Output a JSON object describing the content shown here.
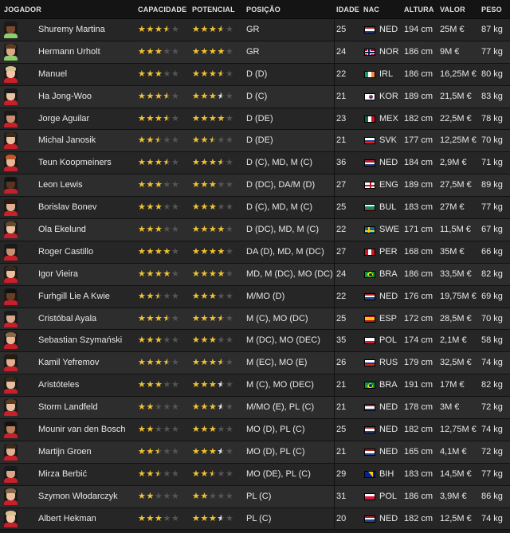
{
  "header": {
    "player": "JOGADOR",
    "ability": "CAPACIDADE",
    "potential": "POTENCIAL",
    "position": "POSIÇÃO",
    "age": "IDADE",
    "nat": "NAC",
    "height": "ALTURA",
    "value": "VALOR",
    "weight": "PESO"
  },
  "colors": {
    "star_gold": "#f2c230",
    "star_white": "#e8e8e8",
    "star_empty": "#555555"
  },
  "players": [
    {
      "name": "Shuremy Martina",
      "ability": 3.5,
      "potential": 3.5,
      "potential_white": false,
      "position": "GR",
      "age": "25",
      "nat": "NED",
      "height": "194 cm",
      "value": "25M €",
      "weight": "87 kg",
      "skin": "#7a4a2e",
      "hair": "#1a1a1a",
      "shirt": "#8ecf6a",
      "flag": "NED"
    },
    {
      "name": "Hermann Urholt",
      "ability": 3,
      "potential": 4,
      "potential_white": false,
      "position": "GR",
      "age": "24",
      "nat": "NOR",
      "height": "186 cm",
      "value": "9M €",
      "weight": "77 kg",
      "skin": "#d9a98a",
      "hair": "#5a3a22",
      "shirt": "#8ecf6a",
      "flag": "NOR"
    },
    {
      "name": "Manuel",
      "ability": 3,
      "potential": 3.5,
      "potential_white": false,
      "position": "D (D)",
      "age": "22",
      "nat": "IRL",
      "height": "186 cm",
      "value": "16,25M €",
      "weight": "80 kg",
      "skin": "#f0c6a8",
      "hair": "#d8c090",
      "shirt": "#c8202a",
      "flag": "IRL"
    },
    {
      "name": "Ha Jong-Woo",
      "ability": 3.5,
      "potential": 3.5,
      "potential_white": true,
      "position": "D (C)",
      "age": "21",
      "nat": "KOR",
      "height": "189 cm",
      "value": "21,5M €",
      "weight": "83 kg",
      "skin": "#e8c4a0",
      "hair": "#1a1a1a",
      "shirt": "#c8202a",
      "flag": "KOR"
    },
    {
      "name": "Jorge Aguilar",
      "ability": 3.5,
      "potential": 4,
      "potential_white": false,
      "position": "D (DE)",
      "age": "23",
      "nat": "MEX",
      "height": "182 cm",
      "value": "22,5M €",
      "weight": "78 kg",
      "skin": "#c89070",
      "hair": "#1a1a1a",
      "shirt": "#c8202a",
      "flag": "MEX"
    },
    {
      "name": "Michal Janosik",
      "ability": 2.5,
      "potential": 2.5,
      "potential_white": false,
      "position": "D (DE)",
      "age": "21",
      "nat": "SVK",
      "height": "177 cm",
      "value": "12,25M €",
      "weight": "70 kg",
      "skin": "#e8c0a0",
      "hair": "#3a2a1a",
      "shirt": "#c8202a",
      "flag": "SVK"
    },
    {
      "name": "Teun Koopmeiners",
      "ability": 3.5,
      "potential": 3.5,
      "potential_white": false,
      "position": "D (C), MD, M (C)",
      "age": "36",
      "nat": "NED",
      "height": "184 cm",
      "value": "2,9M €",
      "weight": "71 kg",
      "skin": "#e8b898",
      "hair": "#c0582a",
      "shirt": "#c8202a",
      "flag": "NED"
    },
    {
      "name": "Leon Lewis",
      "ability": 3,
      "potential": 3,
      "potential_white": false,
      "position": "D (DC), DA/M (D)",
      "age": "27",
      "nat": "ENG",
      "height": "189 cm",
      "value": "27,5M €",
      "weight": "89 kg",
      "skin": "#5a3420",
      "hair": "#111111",
      "shirt": "#c8202a",
      "flag": "ENG"
    },
    {
      "name": "Borislav Bonev",
      "ability": 3,
      "potential": 3,
      "potential_white": false,
      "position": "D (C), MD, M (C)",
      "age": "25",
      "nat": "BUL",
      "height": "183 cm",
      "value": "27M €",
      "weight": "77 kg",
      "skin": "#e0b090",
      "hair": "#2a1a10",
      "shirt": "#c8202a",
      "flag": "BUL"
    },
    {
      "name": "Ola Ekelund",
      "ability": 3,
      "potential": 4,
      "potential_white": false,
      "position": "D (DC), MD, M (C)",
      "age": "22",
      "nat": "SWE",
      "height": "171 cm",
      "value": "11,5M €",
      "weight": "67 kg",
      "skin": "#ecc4a4",
      "hair": "#6a4a2a",
      "shirt": "#c8202a",
      "flag": "SWE"
    },
    {
      "name": "Roger Castillo",
      "ability": 4,
      "potential": 4,
      "potential_white": false,
      "position": "DA (D), MD, M (DC)",
      "age": "27",
      "nat": "PER",
      "height": "168 cm",
      "value": "35M €",
      "weight": "66 kg",
      "skin": "#c89070",
      "hair": "#1a1a1a",
      "shirt": "#c8202a",
      "flag": "PER"
    },
    {
      "name": "Igor Vieira",
      "ability": 4,
      "potential": 4,
      "potential_white": false,
      "position": "MD, M (DC), MO (DC)",
      "age": "24",
      "nat": "BRA",
      "height": "186 cm",
      "value": "33,5M €",
      "weight": "82 kg",
      "skin": "#e8c0a0",
      "hair": "#3a2a1a",
      "shirt": "#c8202a",
      "flag": "BRA"
    },
    {
      "name": "Furhgill Lie A Kwie",
      "ability": 2.5,
      "potential": 3,
      "potential_white": false,
      "position": "M/MO (D)",
      "age": "22",
      "nat": "NED",
      "height": "176 cm",
      "value": "19,75M €",
      "weight": "69 kg",
      "skin": "#6a3e24",
      "hair": "#111111",
      "shirt": "#c8202a",
      "flag": "NED"
    },
    {
      "name": "Cristóbal Ayala",
      "ability": 3.5,
      "potential": 3.5,
      "potential_white": false,
      "position": "M (C), MO (DC)",
      "age": "25",
      "nat": "ESP",
      "height": "172 cm",
      "value": "28,5M €",
      "weight": "70 kg",
      "skin": "#d8a888",
      "hair": "#1a1a1a",
      "shirt": "#c8202a",
      "flag": "ESP"
    },
    {
      "name": "Sebastian Szymański",
      "ability": 3,
      "potential": 3,
      "potential_white": false,
      "position": "M (DC), MO (DEC)",
      "age": "35",
      "nat": "POL",
      "height": "174 cm",
      "value": "2,1M €",
      "weight": "58 kg",
      "skin": "#e8b898",
      "hair": "#8a6a4a",
      "shirt": "#c8202a",
      "flag": "POL"
    },
    {
      "name": "Kamil Yefremov",
      "ability": 3.5,
      "potential": 3.5,
      "potential_white": false,
      "position": "M (EC), MO (E)",
      "age": "26",
      "nat": "RUS",
      "height": "179 cm",
      "value": "32,5M €",
      "weight": "74 kg",
      "skin": "#e0b090",
      "hair": "#2a1a10",
      "shirt": "#c8202a",
      "flag": "RUS"
    },
    {
      "name": "Aristóteles",
      "ability": 3,
      "potential": 3.5,
      "potential_white": true,
      "position": "M (C), MO (DEC)",
      "age": "21",
      "nat": "BRA",
      "height": "191 cm",
      "value": "17M €",
      "weight": "82 kg",
      "skin": "#e8c0a0",
      "hair": "#3a2a1a",
      "shirt": "#c8202a",
      "flag": "BRA"
    },
    {
      "name": "Storm Landfeld",
      "ability": 2,
      "potential": 3.5,
      "potential_white": true,
      "position": "M/MO (E), PL (C)",
      "age": "21",
      "nat": "NED",
      "height": "178 cm",
      "value": "3M €",
      "weight": "72 kg",
      "skin": "#e8c0a0",
      "hair": "#5a3a22",
      "shirt": "#c8202a",
      "flag": "NED"
    },
    {
      "name": "Mounir van den Bosch",
      "ability": 2,
      "potential": 3,
      "potential_white": false,
      "position": "MO (D), PL (C)",
      "age": "25",
      "nat": "NED",
      "height": "182 cm",
      "value": "12,75M €",
      "weight": "74 kg",
      "skin": "#b88060",
      "hair": "#111111",
      "shirt": "#c8202a",
      "flag": "NED"
    },
    {
      "name": "Martijn Groen",
      "ability": 2.5,
      "potential": 3.5,
      "potential_white": true,
      "position": "MO (D), PL (C)",
      "age": "21",
      "nat": "NED",
      "height": "165 cm",
      "value": "4,1M €",
      "weight": "72 kg",
      "skin": "#e0b090",
      "hair": "#3a2a1a",
      "shirt": "#c8202a",
      "flag": "NED"
    },
    {
      "name": "Mirza Berbić",
      "ability": 2.5,
      "potential": 2.5,
      "potential_white": false,
      "position": "MO (DE), PL (C)",
      "age": "29",
      "nat": "BIH",
      "height": "183 cm",
      "value": "14,5M €",
      "weight": "77 kg",
      "skin": "#d8a888",
      "hair": "#1a1a1a",
      "shirt": "#c8202a",
      "flag": "BIH"
    },
    {
      "name": "Szymon Włodarczyk",
      "ability": 2,
      "potential": 2,
      "potential_white": false,
      "position": "PL (C)",
      "age": "31",
      "nat": "POL",
      "height": "186 cm",
      "value": "3,9M €",
      "weight": "86 kg",
      "skin": "#e8c0a0",
      "hair": "#8a6a4a",
      "shirt": "#c8202a",
      "flag": "POL"
    },
    {
      "name": "Albert Hekman",
      "ability": 3,
      "potential": 3.5,
      "potential_white": true,
      "position": "PL (C)",
      "age": "20",
      "nat": "NED",
      "height": "182 cm",
      "value": "12,5M €",
      "weight": "74 kg",
      "skin": "#f0c8a8",
      "hair": "#d8c090",
      "shirt": "#c8202a",
      "flag": "NED"
    }
  ]
}
